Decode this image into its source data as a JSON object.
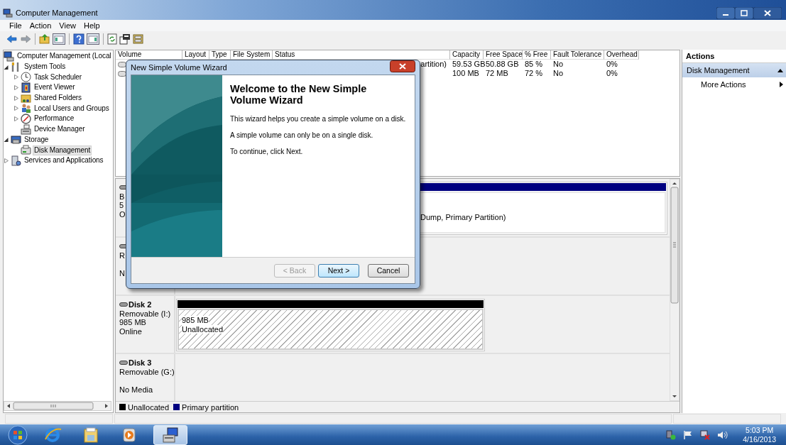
{
  "window": {
    "title": "Computer Management"
  },
  "menu": [
    "File",
    "Action",
    "View",
    "Help"
  ],
  "toolbar": {
    "back": {
      "disabled": false
    },
    "forward": {
      "disabled": true
    }
  },
  "tree": {
    "root": {
      "label": "Computer Management (Local",
      "selected": false
    },
    "items": [
      {
        "label": "System Tools",
        "expanded": true,
        "selected": false,
        "children": [
          {
            "label": "Task Scheduler",
            "expanded": false,
            "selected": false
          },
          {
            "label": "Event Viewer",
            "expanded": false,
            "selected": false
          },
          {
            "label": "Shared Folders",
            "expanded": false,
            "selected": false
          },
          {
            "label": "Local Users and Groups",
            "expanded": false,
            "selected": false
          },
          {
            "label": "Performance",
            "expanded": false,
            "selected": false
          },
          {
            "label": "Device Manager",
            "selected": false
          }
        ]
      },
      {
        "label": "Storage",
        "expanded": true,
        "selected": false,
        "children": [
          {
            "label": "Disk Management",
            "selected": true
          }
        ]
      },
      {
        "label": "Services and Applications",
        "expanded": false,
        "selected": false
      }
    ]
  },
  "volumes": {
    "columns": [
      "Volume",
      "Layout",
      "Type",
      "File System",
      "Status",
      "Capacity",
      "Free Space",
      "% Free",
      "Fault Tolerance",
      "Overhead"
    ],
    "rows": [
      {
        "status": "artition)",
        "capacity": "59.53 GB",
        "free_space": "50.88 GB",
        "percent_free": "85 %",
        "fault_tolerance": "No",
        "overhead": "0%"
      },
      {
        "capacity": "100 MB",
        "free_space": "72 MB",
        "percent_free": "72 %",
        "fault_tolerance": "No",
        "overhead": "0%"
      }
    ]
  },
  "disks": [
    {
      "kind": "basic",
      "type": "B",
      "size": "5",
      "status": "O",
      "partitions": [
        {
          "kind": "primary",
          "lines": [
            "Dump, Primary Partition)"
          ]
        }
      ]
    },
    {
      "kind": "removable",
      "type": "R",
      "status": "N"
    },
    {
      "kind": "removable",
      "name": "Disk 2",
      "type": "Removable (I:)",
      "size": "985 MB",
      "status": "Online",
      "partitions": [
        {
          "kind": "unallocated",
          "lines": [
            "985 MB",
            "Unallocated"
          ]
        }
      ]
    },
    {
      "kind": "removable",
      "name": "Disk 3",
      "type": "Removable (G:)",
      "status": "No Media"
    }
  ],
  "legend": [
    {
      "label": "Unallocated",
      "color": "#000000"
    },
    {
      "label": "Primary partition",
      "color": "#000080"
    }
  ],
  "actions": {
    "title": "Actions",
    "sections": [
      {
        "label": "Disk Management",
        "expanded": true,
        "items": [
          "More Actions"
        ]
      }
    ]
  },
  "dialog": {
    "title": "New Simple Volume Wizard",
    "heading": "Welcome to the New Simple Volume Wizard",
    "paragraphs": [
      "This wizard helps you create a simple volume on a disk.",
      "A simple volume can only be on a single disk.",
      "To continue, click Next."
    ],
    "buttons": [
      {
        "label": "< Back",
        "disabled": true,
        "default": false
      },
      {
        "label": "Next >",
        "disabled": false,
        "default": true
      },
      {
        "label": "Cancel",
        "disabled": false,
        "default": false
      }
    ]
  },
  "taskbar": {
    "apps": [
      {
        "selected": false
      },
      {
        "selected": false
      },
      {
        "selected": false
      },
      {
        "selected": true
      }
    ],
    "time": "5:03 PM",
    "date": "4/16/2013"
  }
}
